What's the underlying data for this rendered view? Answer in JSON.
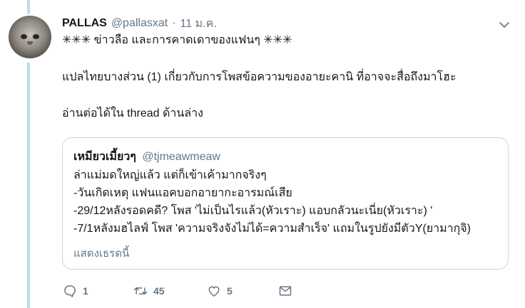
{
  "tweet": {
    "author_name": "PALLAS",
    "author_handle": "@pallasxat",
    "separator": "·",
    "time": "11 ม.ค.",
    "lines": [
      "✳✳✳ ข่าวลือ และการคาดเดาของแฟนๆ ✳✳✳",
      "แปลไทยบางส่วน (1) เกี่ยวกับการโพสข้อความของอายะคานิ ที่อาจจะสื่อถึงมาโฮะ",
      "อ่านต่อได้ใน thread ด้านล่าง"
    ]
  },
  "quoted_tweet": {
    "author_name": "เหมียวเมี้ยวๆ",
    "author_handle": "@tjmeawmeaw",
    "lines": [
      "ล่าแม่มดใหญ่แล้ว แต่ก็เข้าเค้ามากจริงๆ",
      "-วันเกิดเหตุ แฟนแอคบอกอายากะอารมณ์เสีย",
      "-29/12หลังรอดคดี? โพส 'ไม่เป็นไรแล้ว(หัวเราะ) แอบกลัวนะเนี่ย(หัวเราะ) '",
      "-7/1หลังมฮไลฟ์ โพส 'ความจริงจังไม่ได้=ความสำเร็จ' แถมในรูปยังมีตัวY(ยามากุจิ)"
    ],
    "show_thread_label": "แสดงเธรดนี้"
  },
  "actions": {
    "reply_count": "1",
    "retweet_count": "45",
    "like_count": "5"
  },
  "icons": {
    "menu": "chevron-down-icon",
    "reply": "reply-icon",
    "retweet": "retweet-icon",
    "like": "heart-icon",
    "dm": "envelope-icon"
  },
  "colors": {
    "thread_line": "#b7dcf3",
    "secondary_text": "#657786",
    "border": "#ccd6dd"
  }
}
